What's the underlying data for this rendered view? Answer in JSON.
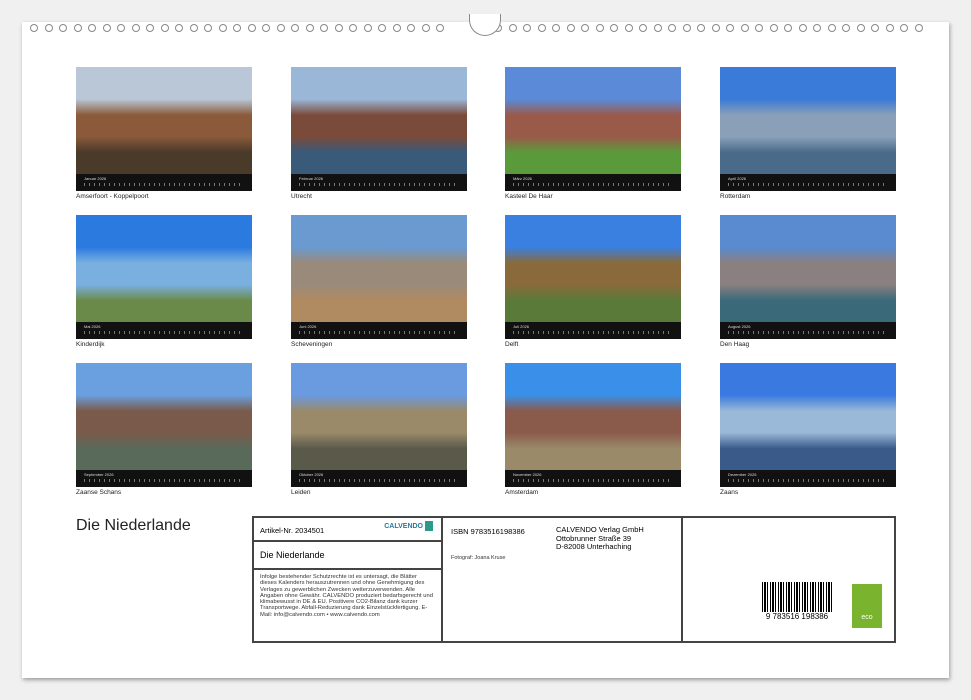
{
  "title": "Die Niederlande",
  "months": [
    {
      "label": "Januar 2026",
      "caption": "Amserfoort - Koppelpoort",
      "colors": [
        "#b9c7d6",
        "#8a5a3a",
        "#4a3a2a"
      ]
    },
    {
      "label": "Februar 2026",
      "caption": "Utrecht",
      "colors": [
        "#9bb7d8",
        "#7a4a3a",
        "#3a5a7a"
      ]
    },
    {
      "label": "März 2026",
      "caption": "Kasteel De Haar",
      "colors": [
        "#5a8ad8",
        "#9a5a4a",
        "#5a9a3a"
      ]
    },
    {
      "label": "April 2026",
      "caption": "Rotterdam",
      "colors": [
        "#3a7ad8",
        "#8aa0b8",
        "#4a6a8a"
      ]
    },
    {
      "label": "Mai 2026",
      "caption": "Kinderdijk",
      "colors": [
        "#2a7ae0",
        "#7ab0e0",
        "#6a8a4a"
      ]
    },
    {
      "label": "Juni 2026",
      "caption": "Scheveningen",
      "colors": [
        "#6a9ad0",
        "#9a8a7a",
        "#b08a60"
      ]
    },
    {
      "label": "Juli 2026",
      "caption": "Delft",
      "colors": [
        "#3a80e0",
        "#8a6a3a",
        "#5a7a3a"
      ]
    },
    {
      "label": "August 2026",
      "caption": "Den Haag",
      "colors": [
        "#5a8ad0",
        "#8a8080",
        "#3a6a7a"
      ]
    },
    {
      "label": "September 2026",
      "caption": "Zaanse Schans",
      "colors": [
        "#6aa0e0",
        "#7a5a4a",
        "#5a6a5a"
      ]
    },
    {
      "label": "Oktober 2026",
      "caption": "Leiden",
      "colors": [
        "#6a9ae0",
        "#9a8a6a",
        "#5a5a4a"
      ]
    },
    {
      "label": "November 2026",
      "caption": "Amsterdam",
      "colors": [
        "#3a90e8",
        "#8a5a4a",
        "#9a8a6a"
      ]
    },
    {
      "label": "Dezember 2026",
      "caption": "Zaans",
      "colors": [
        "#3a7ae0",
        "#9ab8d8",
        "#3a5a8a"
      ]
    }
  ],
  "info": {
    "artikel": "Artikel-Nr. 2034501",
    "logo": "CALVENDO",
    "name": "Die Niederlande",
    "legal": "Infolge bestehender Schutzrechte ist es untersagt, die Blätter dieses Kalenders herauszutrennen und ohne Genehmigung des Verlages zu gewerblichen Zwecken weiterzuverwenden. Alle Angaben ohne Gewähr. CALVENDO produziert bedarfsgerecht und klimabewusst in DE & EU. Positivere CO2-Bilanz dank kurzer Transportwege. Abfall-Reduzierung dank Einzelstückfertigung. E-Mail: info@calvendo.com • www.calvendo.com",
    "isbn": "ISBN 9783516198386",
    "publisher": [
      "CALVENDO Verlag GmbH",
      "Ottobrunner Straße 39",
      "D-82008 Unterhaching"
    ],
    "fotograf": "Fotograf: Joana Kruse",
    "barcode": "9 783516 198386",
    "eco": "eco"
  }
}
